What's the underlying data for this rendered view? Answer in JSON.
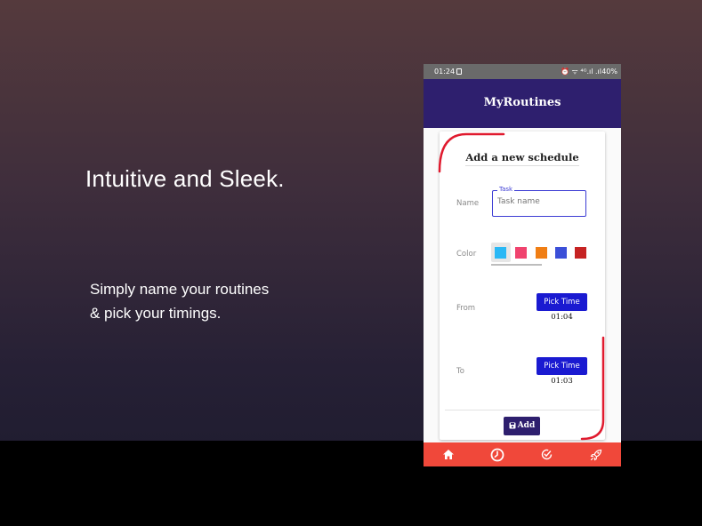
{
  "promo": {
    "headline": "Intuitive and Sleek.",
    "sub_line1": "Simply name your routines",
    "sub_line2": "& pick your timings."
  },
  "status_bar": {
    "time": "01:24",
    "icons": "⏰ ᯤ ⁴ᴳ.ıl .ıl",
    "battery": "40%"
  },
  "app": {
    "title": "MyRoutines",
    "header_color": "#2e1f6e"
  },
  "form": {
    "title": "Add a new schedule",
    "name_label": "Name",
    "task_legend": "Task",
    "task_placeholder": "Task name",
    "task_value": "",
    "color_label": "Color",
    "colors": [
      {
        "name": "light-blue",
        "hex": "#2ab8f5",
        "selected": true
      },
      {
        "name": "pink",
        "hex": "#f0436e",
        "selected": false
      },
      {
        "name": "orange",
        "hex": "#f07e14",
        "selected": false
      },
      {
        "name": "blue",
        "hex": "#3b4fd8",
        "selected": false
      },
      {
        "name": "red",
        "hex": "#c62323",
        "selected": false
      }
    ],
    "from_label": "From",
    "from_button": "Pick Time",
    "from_time": "01:04",
    "to_label": "To",
    "to_button": "Pick Time",
    "to_time": "01:03",
    "add_button": "Add"
  },
  "bottom_nav": {
    "color": "#f0483a",
    "items": [
      {
        "icon": "home-icon"
      },
      {
        "icon": "clock-icon",
        "active": true
      },
      {
        "icon": "check-circle-icon"
      },
      {
        "icon": "rocket-icon"
      }
    ]
  }
}
